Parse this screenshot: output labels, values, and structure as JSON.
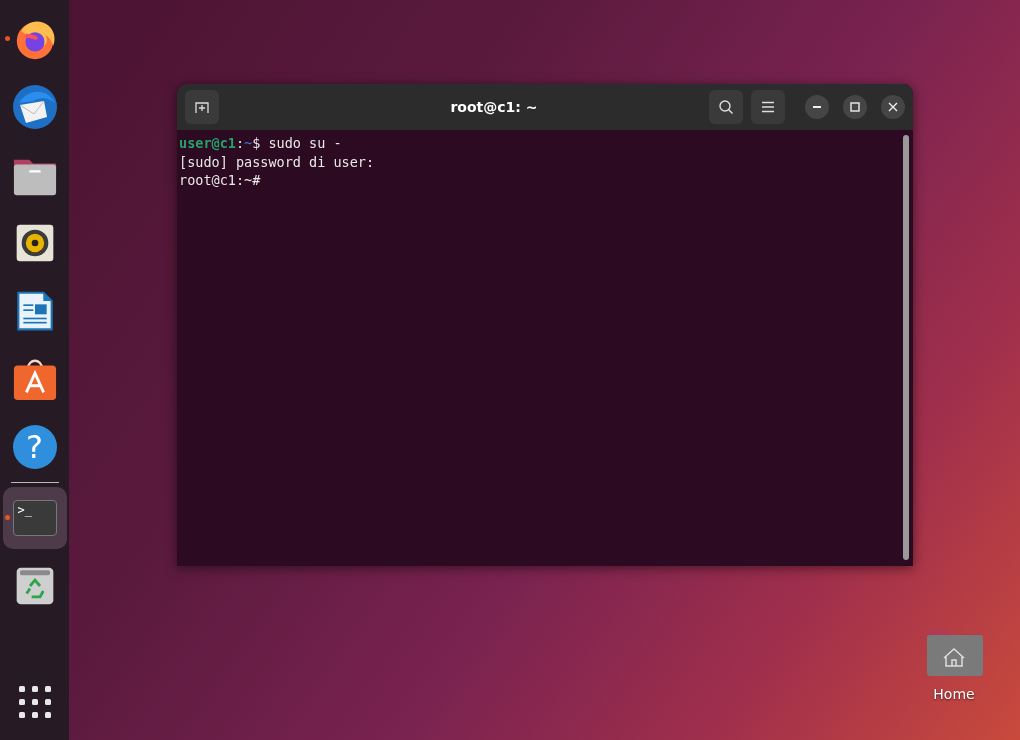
{
  "dock": {
    "items": [
      {
        "kind": "firefox",
        "running": true,
        "selected": false
      },
      {
        "kind": "thunderbird",
        "running": false,
        "selected": false
      },
      {
        "kind": "files",
        "running": false,
        "selected": false
      },
      {
        "kind": "rhythmbox",
        "running": false,
        "selected": false
      },
      {
        "kind": "writer",
        "running": false,
        "selected": false
      },
      {
        "kind": "software",
        "running": false,
        "selected": false
      },
      {
        "kind": "help",
        "glyph": "?",
        "running": false,
        "selected": false
      },
      {
        "kind": "separator"
      },
      {
        "kind": "terminal",
        "glyph": ">_",
        "running": true,
        "selected": true
      },
      {
        "kind": "trash",
        "running": false,
        "selected": false
      }
    ]
  },
  "terminal": {
    "title": "root@c1: ~",
    "lines": [
      [
        {
          "kind": "userhost",
          "text": "user@c1"
        },
        {
          "kind": "plain",
          "text": ":"
        },
        {
          "kind": "path",
          "text": "~"
        },
        {
          "kind": "plain",
          "text": "$ sudo su -"
        }
      ],
      [
        {
          "kind": "plain",
          "text": "[sudo] password di user:"
        }
      ],
      [
        {
          "kind": "plain",
          "text": "root@c1:~#"
        }
      ]
    ]
  },
  "desktop_icons": [
    {
      "label": "Home"
    }
  ]
}
